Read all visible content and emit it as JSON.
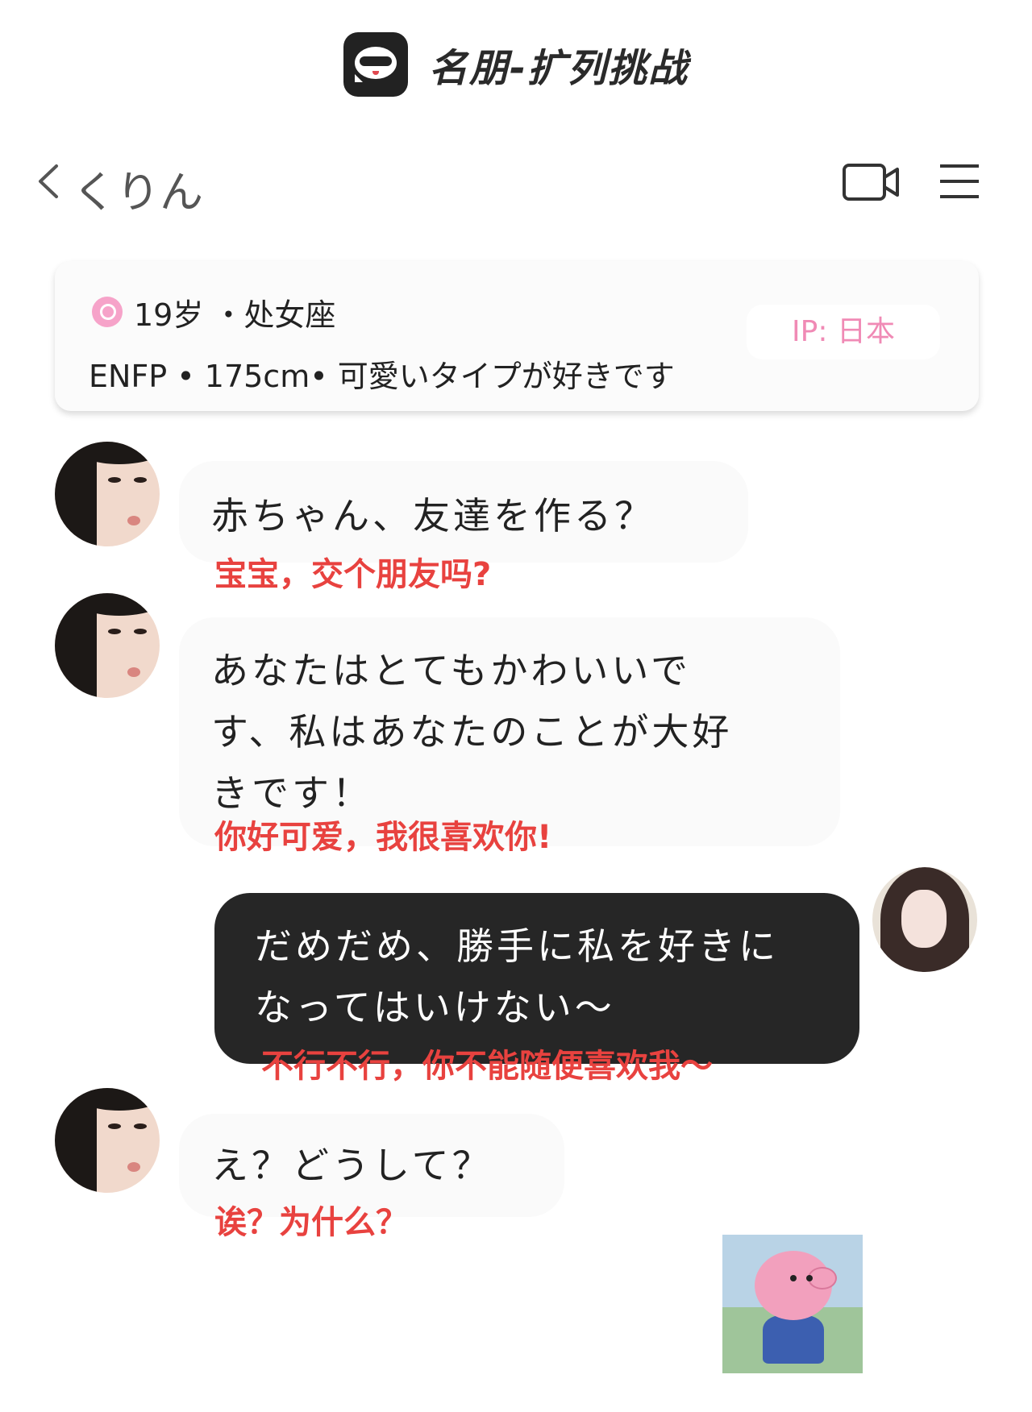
{
  "banner": {
    "title": "名朋-扩列挑战"
  },
  "header": {
    "contact_name": "くりん"
  },
  "profile": {
    "line1": "19岁 ・处女座",
    "line2": "ENFP • 175cm• 可愛いタイプが好きです",
    "ip_label": "IP: 日本"
  },
  "messages": [
    {
      "side": "incoming",
      "text_ja": "赤ちゃん、友達を作る？",
      "text_cn": "宝宝，交个朋友吗?"
    },
    {
      "side": "incoming",
      "text_ja_line1": "あなたはとてもかわいいで",
      "text_ja_line2": "す、私はあなたのことが大好",
      "text_ja_line3": "きです！",
      "text_cn": "你好可爱，我很喜欢你!"
    },
    {
      "side": "outgoing",
      "text_ja_line1": "だめだめ、勝手に私を好きに",
      "text_ja_line2": "なってはいけない～",
      "text_cn": "不行不行，你不能随便喜欢我～"
    },
    {
      "side": "incoming",
      "text_ja": "え？どうして？",
      "text_cn": "诶？为什么？"
    }
  ],
  "colors": {
    "accent_pink": "#f08ab5",
    "translation_red": "#e8423f",
    "outgoing_bubble": "#262626"
  }
}
